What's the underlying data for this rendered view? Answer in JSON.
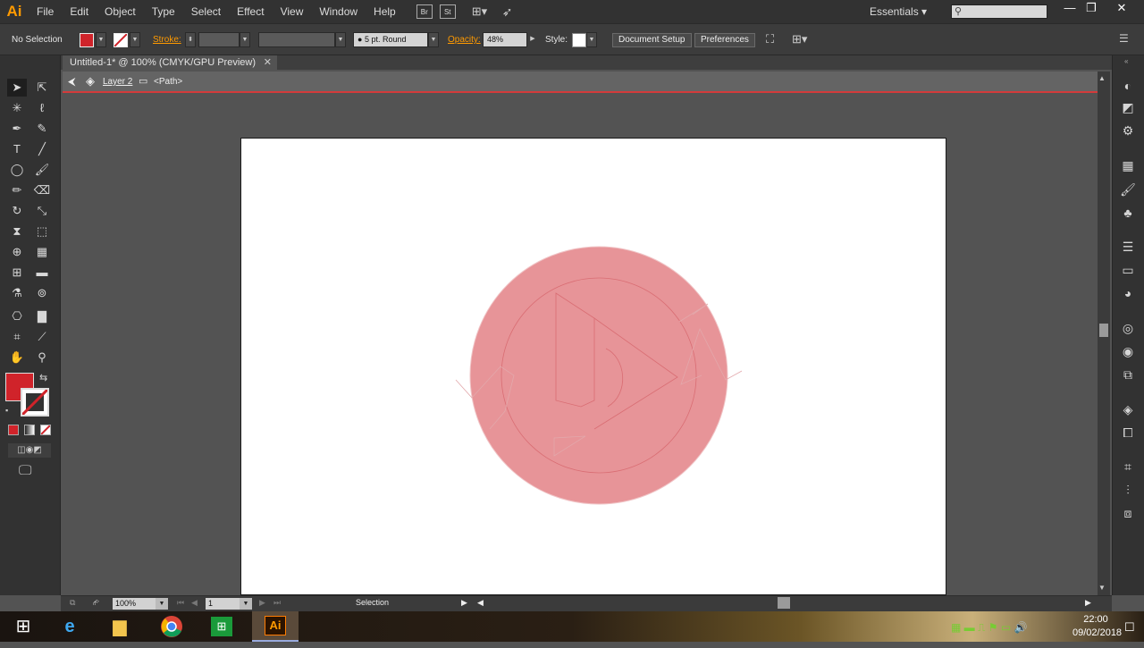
{
  "app": {
    "logo": "Ai"
  },
  "menu": [
    "File",
    "Edit",
    "Object",
    "Type",
    "Select",
    "Effect",
    "View",
    "Window",
    "Help"
  ],
  "menubar_buttons": {
    "br": "Br",
    "st": "St"
  },
  "workspace": "Essentials",
  "window_controls": {
    "minimize": "—",
    "restore": "❐",
    "close": "✕"
  },
  "control_bar": {
    "selection_label": "No Selection",
    "stroke_label": "Stroke:",
    "brush_label": "5 pt. Round",
    "opacity_label": "Opacity:",
    "opacity_value": "48%",
    "style_label": "Style:",
    "document_setup": "Document Setup",
    "preferences": "Preferences"
  },
  "document_tab": {
    "title": "Untitled-1* @ 100% (CMYK/GPU Preview)",
    "close": "✕"
  },
  "isolation": {
    "layer": "Layer 2",
    "object": "<Path>"
  },
  "status_bar": {
    "zoom": "100%",
    "artboard": "1",
    "tool": "Selection"
  },
  "taskbar": {
    "time": "22:00",
    "date": "09/02/2018"
  },
  "colors": {
    "fill": "#d0232a",
    "accent": "#ff9a00",
    "isolation_line": "#d33b3b",
    "artwork_fill": "#e79498"
  }
}
